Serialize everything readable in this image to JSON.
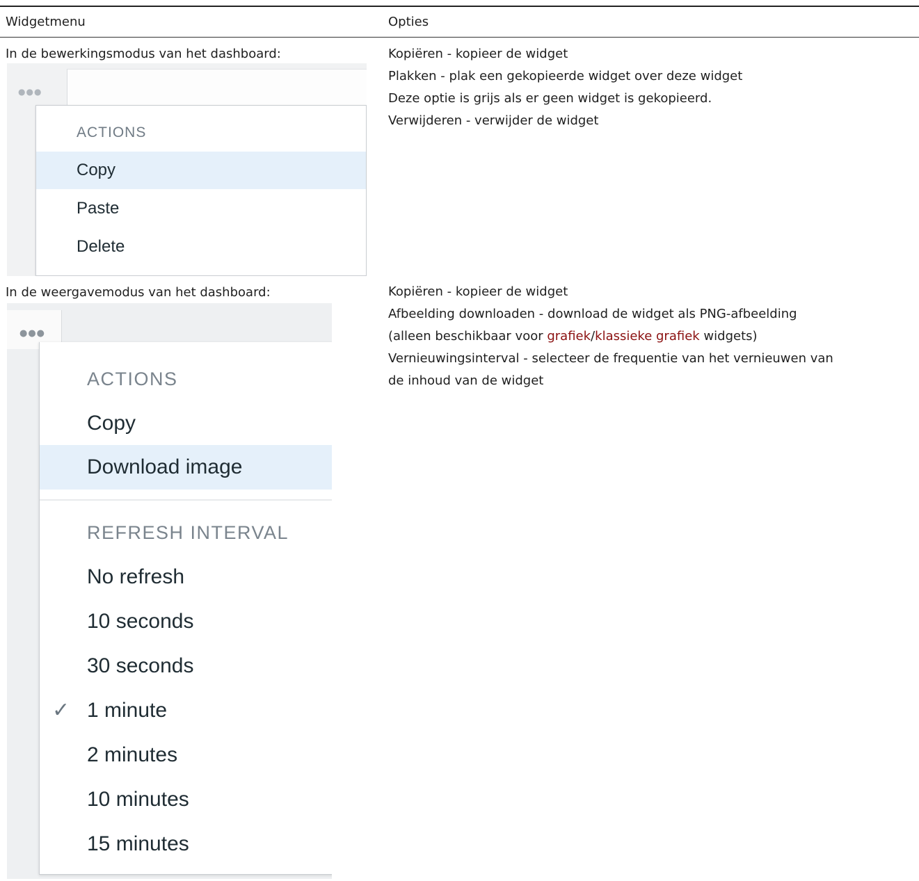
{
  "table": {
    "headers": [
      "Widgetmenu",
      "Opties"
    ],
    "rows": [
      {
        "menu_label": "In de bewerkingsmodus van het dashboard:",
        "options": [
          "Kopiëren - kopieer de widget",
          "Plakken - plak een gekopieerde widget over deze widget",
          "Deze optie is grijs als er geen widget is gekopieerd.",
          "Verwijderen - verwijder de widget"
        ],
        "screenshot": {
          "section": "ACTIONS",
          "items": [
            "Copy",
            "Paste",
            "Delete"
          ],
          "highlighted": "Copy"
        }
      },
      {
        "menu_label": "In de weergavemodus van het dashboard:",
        "options": {
          "line1": "Kopiëren - kopieer de widget",
          "line2": "Afbeelding downloaden - download de widget als PNG-afbeelding",
          "line3_prefix": "(alleen beschikbaar voor ",
          "link1": "grafiek",
          "slash": "/",
          "link2": "klassieke grafiek",
          "line3_suffix": " widgets)",
          "line4": "Vernieuwingsinterval - selecteer de frequentie van het vernieuwen van",
          "line5": "de inhoud van de widget"
        },
        "screenshot": {
          "section1": "ACTIONS",
          "actions": [
            "Copy",
            "Download image"
          ],
          "highlighted": "Download image",
          "section2": "REFRESH INTERVAL",
          "intervals": [
            "No refresh",
            "10 seconds",
            "30 seconds",
            "1 minute",
            "2 minutes",
            "10 minutes",
            "15 minutes"
          ],
          "checked": "1 minute"
        }
      }
    ]
  },
  "colors": {
    "link": "#8b1111",
    "highlight": "#e5f0fa"
  },
  "icons": {
    "menu": "dots-icon",
    "selected": "checkmark-icon"
  }
}
